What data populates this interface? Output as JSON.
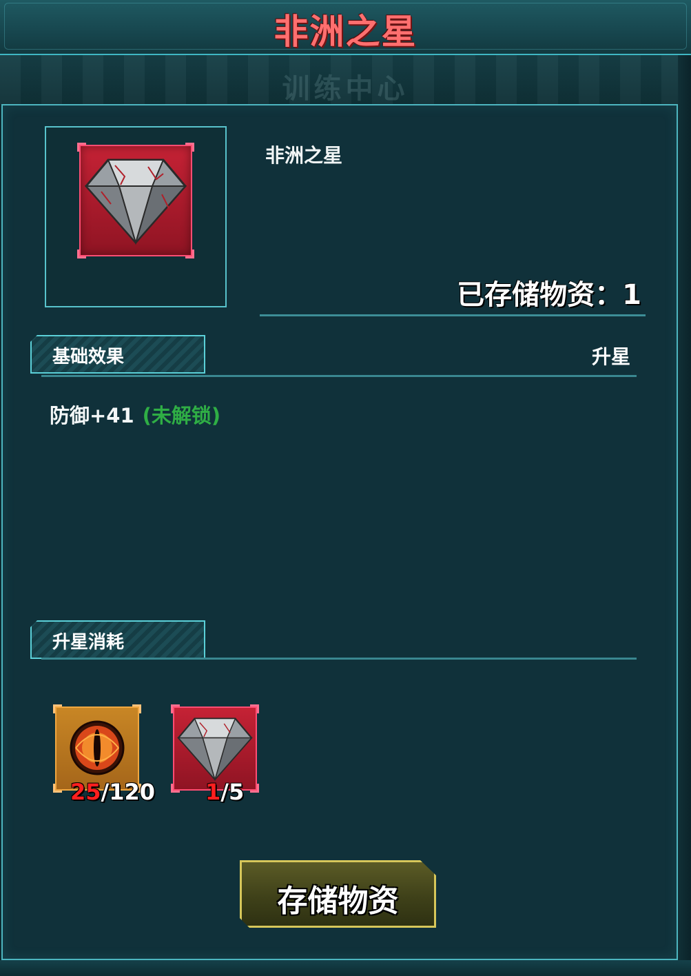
{
  "window": {
    "title": "非洲之星",
    "background_text": "训练中心"
  },
  "item": {
    "name": "非洲之星",
    "icon": "diamond-icon",
    "stored_label": "已存储物资：1"
  },
  "sections": {
    "base_effect": "基础效果",
    "upgrade": "升星",
    "upgrade_cost": "升星消耗"
  },
  "effect": {
    "stat": "防御+41",
    "status": "(未解锁)"
  },
  "costs": [
    {
      "icon": "eye-orb-icon",
      "have": "25",
      "need": "/120"
    },
    {
      "icon": "diamond-icon",
      "have": "1",
      "need": "/5"
    }
  ],
  "buttons": {
    "store": "存储物资"
  },
  "colors": {
    "title": "#ff6f6f",
    "unlock_text": "#2fae45",
    "insufficient": "#ff1f1f",
    "panel_border": "#4db6c0",
    "button_border": "#d7c75a"
  }
}
